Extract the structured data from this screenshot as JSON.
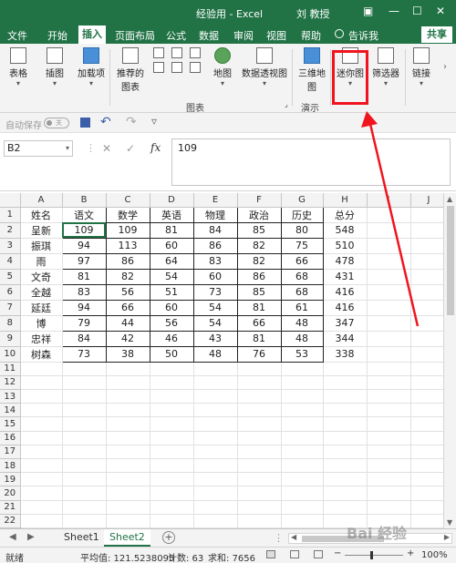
{
  "window": {
    "title": "经验用 - Excel",
    "user": "刘 教授"
  },
  "tabs": [
    "文件",
    "开始",
    "插入",
    "页面布局",
    "公式",
    "数据",
    "审阅",
    "视图",
    "帮助"
  ],
  "active_tab": "插入",
  "tell_me": "告诉我",
  "share_label": "共享",
  "ribbon": {
    "table": "表格",
    "illustrations": "插图",
    "addins": "加载项",
    "recommended_charts_1": "推荐的",
    "recommended_charts_2": "图表",
    "maps": "地图",
    "pivot_chart": "数据透视图",
    "map3d_1": "三维地",
    "map3d_2": "图",
    "sparklines": "迷你图",
    "slicer": "筛选器",
    "link": "链接",
    "group_charts": "图表",
    "group_tours": "演示"
  },
  "quick_access": {
    "autosave_label": "自动保存",
    "autosave_state": "关"
  },
  "formula_bar": {
    "name_box": "B2",
    "cancel": "✕",
    "enter": "✓",
    "fx": "fx",
    "value": "109"
  },
  "columns": [
    "A",
    "B",
    "C",
    "D",
    "E",
    "F",
    "G",
    "H",
    "I",
    "J"
  ],
  "header_row": [
    "姓名",
    "语文",
    "数学",
    "英语",
    "物理",
    "政治",
    "历史",
    "总分"
  ],
  "rows": [
    [
      "呈新",
      "109",
      "109",
      "81",
      "84",
      "85",
      "80",
      "548"
    ],
    [
      "振琪",
      "94",
      "113",
      "60",
      "86",
      "82",
      "75",
      "510"
    ],
    [
      "雨",
      "97",
      "86",
      "64",
      "83",
      "82",
      "66",
      "478"
    ],
    [
      "文奇",
      "81",
      "82",
      "54",
      "60",
      "86",
      "68",
      "431"
    ],
    [
      "全越",
      "83",
      "56",
      "51",
      "73",
      "85",
      "68",
      "416"
    ],
    [
      "延廷",
      "94",
      "66",
      "60",
      "54",
      "81",
      "61",
      "416"
    ],
    [
      "博",
      "79",
      "44",
      "56",
      "54",
      "66",
      "48",
      "347"
    ],
    [
      "忠祥",
      "84",
      "42",
      "46",
      "43",
      "81",
      "48",
      "344"
    ],
    [
      "树森",
      "73",
      "38",
      "50",
      "48",
      "76",
      "53",
      "338"
    ]
  ],
  "row_numbers": [
    "1",
    "2",
    "3",
    "4",
    "5",
    "6",
    "7",
    "8",
    "9",
    "10",
    "11",
    "12",
    "13",
    "14",
    "15",
    "16",
    "17",
    "18",
    "19",
    "20",
    "21",
    "22",
    "23"
  ],
  "sheets": [
    "Sheet1",
    "Sheet2"
  ],
  "active_sheet": "Sheet2",
  "status": {
    "ready": "就绪",
    "average": "平均值: 121.5238095",
    "count": "计数: 63",
    "sum": "求和: 7656",
    "zoom": "100%"
  },
  "watermark": "Bai 经验",
  "colors": {
    "excel_green": "#217346",
    "highlight_red": "#f0141e"
  }
}
